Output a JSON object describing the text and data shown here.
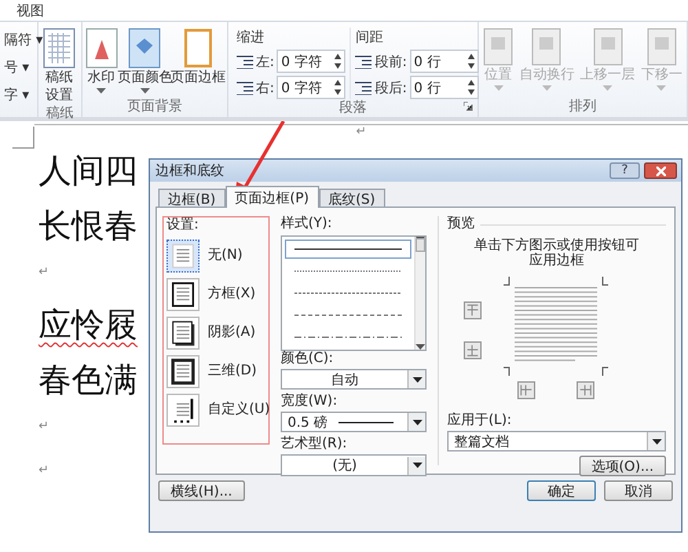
{
  "ribbon": {
    "tab": "视图",
    "left_items": [
      "隔符 ▾",
      "号 ▾",
      "字 ▾"
    ],
    "groups": [
      {
        "kind": "buttons",
        "label": "稿纸",
        "buttons": [
          {
            "lines": [
              "稿纸",
              "设置"
            ],
            "dropdown": false,
            "disabled": false
          }
        ]
      },
      {
        "kind": "buttons",
        "label": "页面背景",
        "buttons": [
          {
            "lines": [
              "水印"
            ],
            "dropdown": true,
            "disabled": false
          },
          {
            "lines": [
              "页面颜色"
            ],
            "dropdown": true,
            "disabled": false
          },
          {
            "lines": [
              "页面边框"
            ],
            "dropdown": false,
            "disabled": false
          }
        ]
      },
      {
        "kind": "paragraph",
        "label": "段落",
        "launcher": true,
        "sections": [
          {
            "title": "缩进",
            "fields": [
              {
                "label": "左:",
                "value": "0 字符"
              },
              {
                "label": "右:",
                "value": "0 字符"
              }
            ]
          },
          {
            "title": "间距",
            "fields": [
              {
                "label": "段前:",
                "value": "0 行"
              },
              {
                "label": "段后:",
                "value": "0 行"
              }
            ]
          }
        ]
      },
      {
        "kind": "buttons",
        "label": "排列",
        "buttons": [
          {
            "lines": [
              "位置"
            ],
            "dropdown": true,
            "disabled": true
          },
          {
            "lines": [
              "自动换行"
            ],
            "dropdown": true,
            "disabled": true
          },
          {
            "lines": [
              "上移一层"
            ],
            "dropdown": true,
            "disabled": true
          },
          {
            "lines": [
              "下移一"
            ],
            "dropdown": true,
            "disabled": true
          }
        ]
      }
    ]
  },
  "document": {
    "header_mark": "↵",
    "paragraphs": [
      {
        "kind": "text",
        "text": "人间四",
        "misspelled": false
      },
      {
        "kind": "text",
        "text": "长恨春",
        "misspelled": false
      },
      {
        "kind": "mark",
        "text": "↵"
      },
      {
        "kind": "text",
        "text": "应怜屐",
        "misspelled": true
      },
      {
        "kind": "text",
        "text": "春色满",
        "misspelled": false
      },
      {
        "kind": "mark",
        "text": "↵"
      },
      {
        "kind": "mark",
        "text": "↵"
      }
    ]
  },
  "dialog": {
    "title": "边框和底纹",
    "help": "?",
    "tabs": [
      {
        "label": "边框(B)",
        "selected": false
      },
      {
        "label": "页面边框(P)",
        "selected": true
      },
      {
        "label": "底纹(S)",
        "selected": false
      }
    ],
    "setting": {
      "label": "设置:",
      "items": [
        {
          "label": "无(N)",
          "selected": true
        },
        {
          "label": "方框(X)",
          "selected": false
        },
        {
          "label": "阴影(A)",
          "selected": false
        },
        {
          "label": "三维(D)",
          "selected": false
        },
        {
          "label": "自定义(U)",
          "selected": false
        }
      ]
    },
    "style": {
      "label": "样式(Y):",
      "lines": [
        {
          "kind": "solid",
          "selected": true
        },
        {
          "kind": "dotted",
          "selected": false
        },
        {
          "kind": "dense",
          "selected": false
        },
        {
          "kind": "dashed",
          "selected": false
        },
        {
          "kind": "dashdot",
          "selected": false
        }
      ]
    },
    "color": {
      "label": "颜色(C):",
      "value": "自动"
    },
    "width": {
      "label": "宽度(W):",
      "value": "0.5 磅"
    },
    "art": {
      "label": "艺术型(R):",
      "value": "(无)"
    },
    "preview": {
      "label": "预览",
      "hint": [
        "单击下方图示或使用按钮可",
        "应用边框"
      ]
    },
    "apply": {
      "label": "应用于(L):",
      "value": "整篇文档"
    },
    "options_button": "选项(O)...",
    "line_button": "横线(H)...",
    "ok_button": "确定",
    "cancel_button": "取消"
  }
}
